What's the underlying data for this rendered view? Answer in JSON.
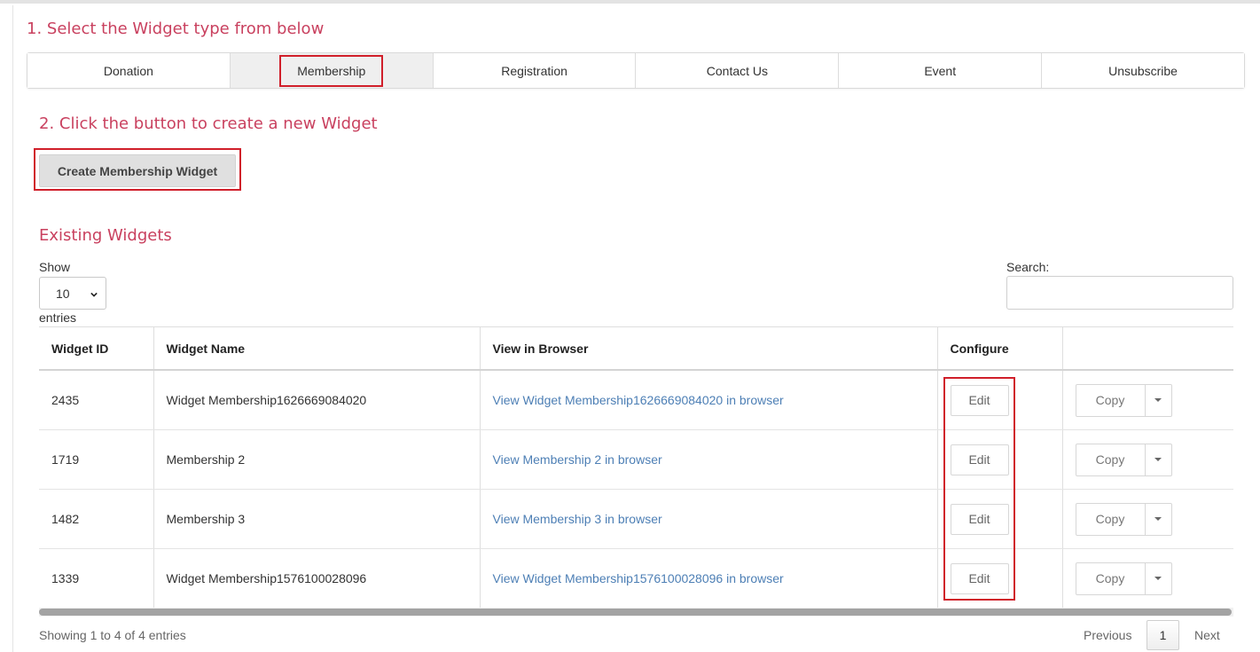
{
  "steps": {
    "select_heading": "1. Select the Widget type from below",
    "create_heading": "2. Click the button to create a new Widget",
    "existing_heading": "Existing Widgets"
  },
  "tabs": [
    {
      "label": "Donation",
      "active": false
    },
    {
      "label": "Membership",
      "active": true
    },
    {
      "label": "Registration",
      "active": false
    },
    {
      "label": "Contact Us",
      "active": false
    },
    {
      "label": "Event",
      "active": false
    },
    {
      "label": "Unsubscribe",
      "active": false
    }
  ],
  "create_button": {
    "label": "Create Membership Widget"
  },
  "length_control": {
    "show_label": "Show",
    "selected": "10",
    "entries_label": "entries"
  },
  "search": {
    "label": "Search:",
    "value": ""
  },
  "table": {
    "columns": [
      "Widget ID",
      "Widget Name",
      "View in Browser",
      "Configure",
      ""
    ],
    "rows": [
      {
        "id": "2435",
        "name": "Widget Membership1626669084020",
        "view": "View Widget Membership1626669084020 in browser",
        "edit": "Edit",
        "copy": "Copy"
      },
      {
        "id": "1719",
        "name": "Membership 2",
        "view": "View Membership 2 in browser",
        "edit": "Edit",
        "copy": "Copy"
      },
      {
        "id": "1482",
        "name": "Membership 3",
        "view": "View Membership 3 in browser",
        "edit": "Edit",
        "copy": "Copy"
      },
      {
        "id": "1339",
        "name": "Widget Membership1576100028096",
        "view": "View Widget Membership1576100028096 in browser",
        "edit": "Edit",
        "copy": "Copy"
      }
    ]
  },
  "footer": {
    "info": "Showing 1 to 4 of 4 entries",
    "previous": "Previous",
    "current_page": "1",
    "next": "Next"
  },
  "colors": {
    "heading": "#c9415f",
    "highlight_outline": "#d01f2a",
    "link": "#4d7fb5"
  },
  "icons": {
    "select_arrow": "chevron-down-icon",
    "copy_dropdown": "caret-down-icon"
  }
}
